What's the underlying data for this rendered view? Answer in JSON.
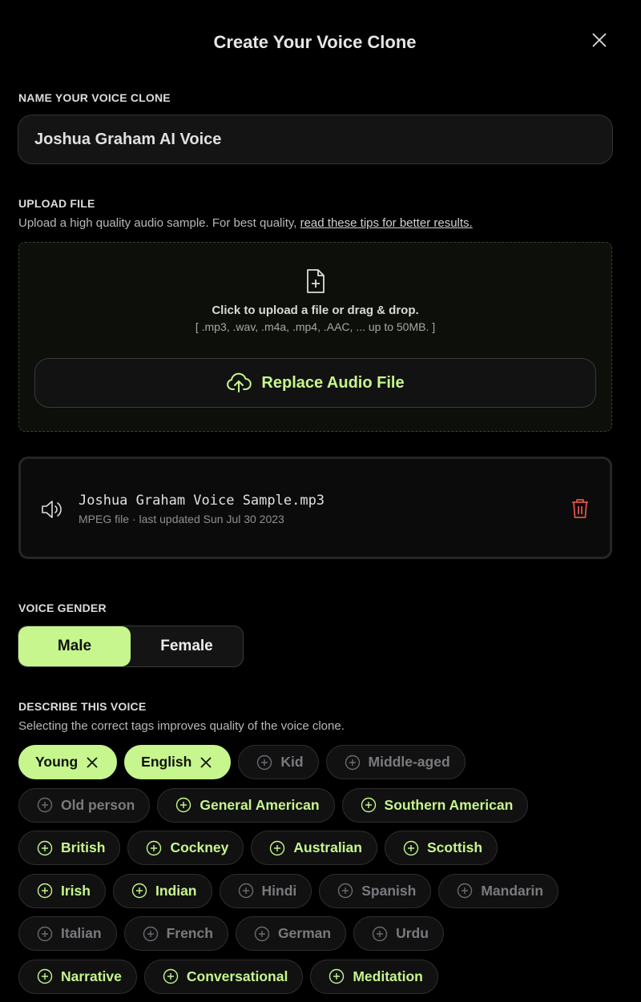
{
  "dialog": {
    "title": "Create Your Voice Clone",
    "close_icon": "close-icon"
  },
  "name_section": {
    "label": "NAME YOUR VOICE CLONE",
    "value": "Joshua Graham AI Voice"
  },
  "upload": {
    "label": "UPLOAD FILE",
    "description": "Upload a high quality audio sample. For best quality, ",
    "tips_link": "read these tips for better results.",
    "drop_title": "Click to upload a file or drag & drop.",
    "drop_formats": "[ .mp3, .wav, .m4a, .mp4, .AAC, ... up to 50MB. ]",
    "replace_button": "Replace Audio File"
  },
  "file": {
    "name": "Joshua Graham Voice Sample.mp3",
    "meta": "MPEG file · last updated Sun Jul 30 2023"
  },
  "gender": {
    "label": "VOICE GENDER",
    "options": [
      "Male",
      "Female"
    ],
    "selected": "Male"
  },
  "describe": {
    "label": "DESCRIBE THIS VOICE",
    "description": "Selecting the correct tags improves quality of the voice clone.",
    "rows": [
      [
        {
          "label": "Young",
          "state": "selected"
        },
        {
          "label": "English",
          "state": "selected"
        },
        {
          "label": "Kid",
          "state": "disabled"
        },
        {
          "label": "Middle-aged",
          "state": "disabled"
        }
      ],
      [
        {
          "label": "Old person",
          "state": "disabled"
        },
        {
          "label": "General American",
          "state": "available"
        },
        {
          "label": "Southern American",
          "state": "available"
        }
      ],
      [
        {
          "label": "British",
          "state": "available"
        },
        {
          "label": "Cockney",
          "state": "available"
        },
        {
          "label": "Australian",
          "state": "available"
        },
        {
          "label": "Scottish",
          "state": "available"
        }
      ],
      [
        {
          "label": "Irish",
          "state": "available"
        },
        {
          "label": "Indian",
          "state": "available"
        },
        {
          "label": "Hindi",
          "state": "disabled"
        },
        {
          "label": "Spanish",
          "state": "disabled"
        },
        {
          "label": "Mandarin",
          "state": "disabled"
        }
      ],
      [
        {
          "label": "Italian",
          "state": "disabled"
        },
        {
          "label": "French",
          "state": "disabled"
        },
        {
          "label": "German",
          "state": "disabled"
        },
        {
          "label": "Urdu",
          "state": "disabled"
        }
      ],
      [
        {
          "label": "Narrative",
          "state": "available"
        },
        {
          "label": "Conversational",
          "state": "available"
        },
        {
          "label": "Meditation",
          "state": "available"
        }
      ]
    ]
  },
  "colors": {
    "accent": "#c6f68d",
    "danger": "#e0534a",
    "background": "#000000"
  }
}
